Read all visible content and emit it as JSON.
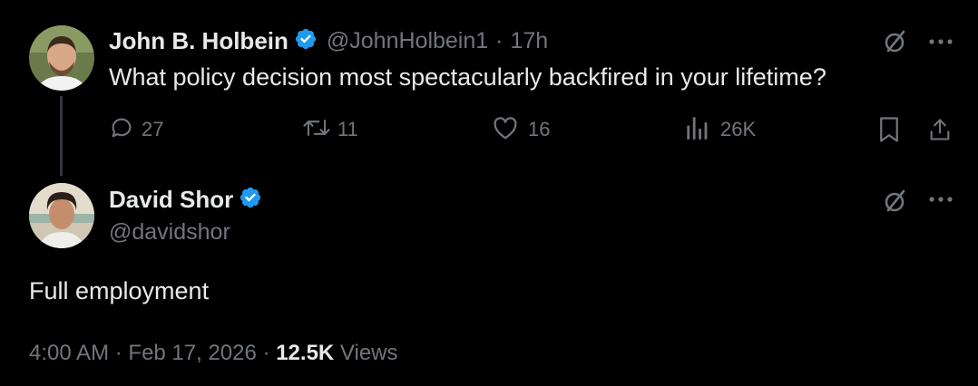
{
  "parent": {
    "name": "John B. Holbein",
    "handle": "@JohnHolbein1",
    "separator": "·",
    "time": "17h",
    "text": "What policy decision most spectacularly backfired in your lifetime?",
    "replies": "27",
    "reposts": "11",
    "likes": "16",
    "views": "26K"
  },
  "reply": {
    "name": "David Shor",
    "handle": "@davidshor",
    "text": "Full employment",
    "time": "4:00 AM",
    "date": "Feb 17, 2026",
    "separator": "·",
    "views_count": "12.5K",
    "views_label": "Views"
  },
  "icons": {
    "verified": "verified-badge-icon",
    "grok": "grok-icon",
    "more": "more-icon",
    "reply": "reply-icon",
    "repost": "repost-icon",
    "like": "like-icon",
    "views": "views-icon",
    "bookmark": "bookmark-icon",
    "share": "share-icon"
  },
  "colors": {
    "verified": "#1d9bf0",
    "muted": "#71767b",
    "text": "#e7e9ea",
    "background": "#000000"
  }
}
